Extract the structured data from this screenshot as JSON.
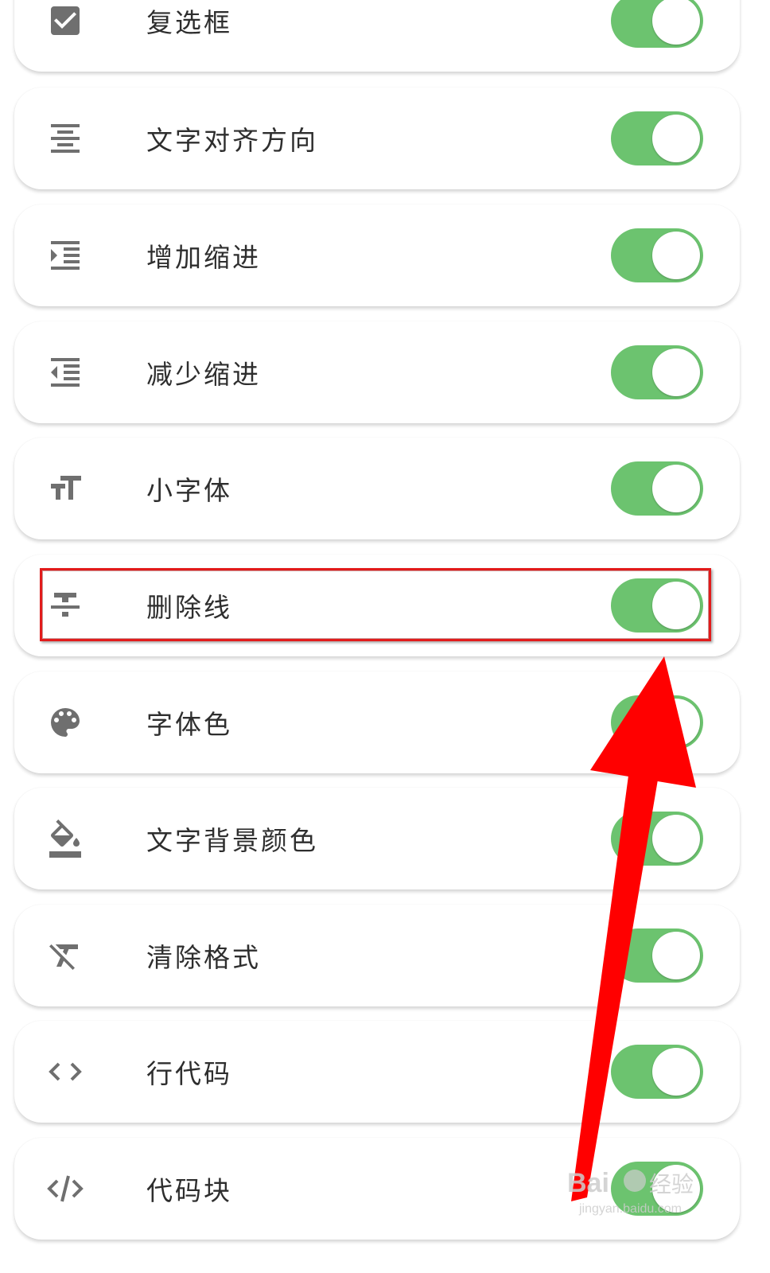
{
  "items": [
    {
      "label": "复选框",
      "icon": "checkbox-icon",
      "enabled": true
    },
    {
      "label": "文字对齐方向",
      "icon": "align-center-icon",
      "enabled": true
    },
    {
      "label": "增加缩进",
      "icon": "indent-increase-icon",
      "enabled": true
    },
    {
      "label": "减少缩进",
      "icon": "indent-decrease-icon",
      "enabled": true
    },
    {
      "label": "小字体",
      "icon": "text-size-icon",
      "enabled": true
    },
    {
      "label": "删除线",
      "icon": "strikethrough-icon",
      "enabled": true
    },
    {
      "label": "字体色",
      "icon": "palette-icon",
      "enabled": true
    },
    {
      "label": "文字背景颜色",
      "icon": "fill-color-icon",
      "enabled": true
    },
    {
      "label": "清除格式",
      "icon": "clear-format-icon",
      "enabled": true
    },
    {
      "label": "行代码",
      "icon": "inline-code-icon",
      "enabled": true
    },
    {
      "label": "代码块",
      "icon": "code-block-icon",
      "enabled": true
    }
  ],
  "colors": {
    "toggle_on": "#6cc36f",
    "highlight": "#e21b1b",
    "arrow": "#ff0000"
  },
  "watermark": {
    "logo": "Baidu经验",
    "url": "jingyan.baidu.com"
  }
}
